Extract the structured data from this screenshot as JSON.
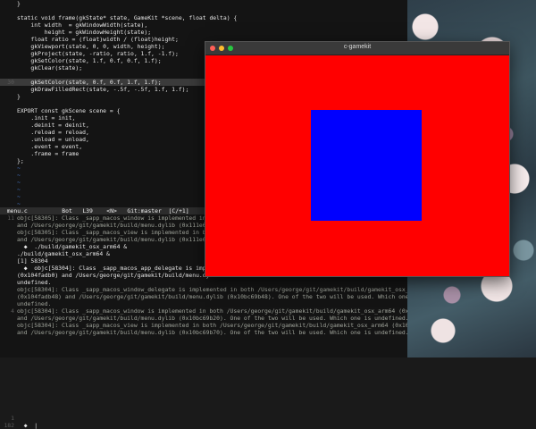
{
  "editor": {
    "code_lines": [
      {
        "num": "",
        "text": "}"
      },
      {
        "num": "",
        "text": ""
      },
      {
        "num": "",
        "text": "static void frame(gkState* state, GameKit *scene, float delta) {"
      },
      {
        "num": "",
        "text": "    int width  = gkWindowWidth(state),"
      },
      {
        "num": "",
        "text": "        height = gkWindowHeight(state);"
      },
      {
        "num": "",
        "text": "    float ratio = (float)width / (float)height;"
      },
      {
        "num": "",
        "text": "    gkViewport(state, 0, 0, width, height);"
      },
      {
        "num": "",
        "text": "    gkProject(state, -ratio, ratio, 1.f, -1.f);"
      },
      {
        "num": "",
        "text": "    gkSetColor(state, 1.f, 0.f, 0.f, 1.f);"
      },
      {
        "num": "",
        "text": "    gkClear(state);"
      },
      {
        "num": "",
        "text": ""
      },
      {
        "num": "30",
        "text": "    gkSetColor(state, 0.f, 0.f, 1.f, 1.f);",
        "highlight": true
      },
      {
        "num": "",
        "text": "    gkDrawFilledRect(state, -.5f, -.5f, 1.f, 1.f);"
      },
      {
        "num": "",
        "text": "}"
      },
      {
        "num": "",
        "text": ""
      },
      {
        "num": "",
        "text": "EXPORT const gkScene scene = {"
      },
      {
        "num": "",
        "text": "    .init = init,"
      },
      {
        "num": "",
        "text": "    .deinit = deinit,"
      },
      {
        "num": "",
        "text": "    .reload = reload,"
      },
      {
        "num": "",
        "text": "    .unload = unload,"
      },
      {
        "num": "",
        "text": "    .event = event,"
      },
      {
        "num": "",
        "text": "    .frame = frame"
      },
      {
        "num": "",
        "text": "};"
      },
      {
        "num": "",
        "text": "~"
      },
      {
        "num": "",
        "text": "~"
      },
      {
        "num": "",
        "text": "~"
      },
      {
        "num": "",
        "text": "~"
      },
      {
        "num": "",
        "text": "~"
      },
      {
        "num": "",
        "text": "~"
      }
    ],
    "status_line": "  menu.c          Bot   L39    <N>   Git:master  [C/+1]"
  },
  "output": {
    "lines": [
      {
        "num": "11",
        "text": "objc[58305]: Class _sapp_macos_window is implemented in both"
      },
      {
        "num": "",
        "text": "and /Users/george/git/gamekit/build/menu.dylib (0x111e69b20)"
      },
      {
        "num": "",
        "text": "objc[58305]: Class _sapp_macos_view is implemented in both /U"
      },
      {
        "num": "",
        "text": "and /Users/george/git/gamekit/build/menu.dylib (0x111e69b70)"
      },
      {
        "num": "",
        "text": "  ◆  ./build/gamekit_osx_arm64 &",
        "bright": true
      },
      {
        "num": "",
        "text": "./build/gamekit_osx_arm64 &",
        "bright": true
      },
      {
        "num": "",
        "text": "[1] 58304",
        "bright": true
      },
      {
        "num": "",
        "text": "  ◆  objc[58304]: Class _sapp_macos_app_delegate is implemented",
        "bright": true
      },
      {
        "num": "",
        "text": "(0x104fadb0) and /Users/george/git/gamekit/build/menu.dylib",
        "bright": true
      },
      {
        "num": "",
        "text": "undefined.",
        "bright": true
      },
      {
        "num": "",
        "text": "objc[58304]: Class _sapp_macos_window_delegate is implemented in both /Users/george/git/gamekit/build/gamekit_osx_arm64"
      },
      {
        "num": "",
        "text": "(0x104fadb48) and /Users/george/git/gamekit/build/menu.dylib (0x10bc69b48). One of the two will be used. Which one is"
      },
      {
        "num": "",
        "text": "undefined."
      },
      {
        "num": "4",
        "text": "objc[58304]: Class _sapp_macos_window is implemented in both /Users/george/git/gamekit/build/gamekit_osx_arm64 (0x104fadb20)"
      },
      {
        "num": "",
        "text": "and /Users/george/git/gamekit/build/menu.dylib (0x10bc69b20). One of the two will be used. Which one is undefined."
      },
      {
        "num": "",
        "text": "objc[58304]: Class _sapp_macos_view is implemented in both /Users/george/git/gamekit/build/gamekit_osx_arm64 (0x104fadb70)"
      },
      {
        "num": "",
        "text": "and /Users/george/git/gamekit/build/menu.dylib (0x10bc69b70). One of the two will be used. Which one is undefined."
      },
      {
        "num": "",
        "text": ""
      },
      {
        "num": "",
        "text": ""
      },
      {
        "num": "",
        "text": ""
      },
      {
        "num": "",
        "text": ""
      },
      {
        "num": "",
        "text": ""
      },
      {
        "num": "",
        "text": ""
      },
      {
        "num": "",
        "text": ""
      },
      {
        "num": "",
        "text": ""
      },
      {
        "num": "",
        "text": ""
      },
      {
        "num": "",
        "text": ""
      },
      {
        "num": "",
        "text": ""
      },
      {
        "num": "1",
        "text": ""
      },
      {
        "num": "182",
        "text": "  ◆  |",
        "bright": true
      }
    ]
  },
  "gamekit_window": {
    "title": "c-gamekit",
    "clear_color": "#ff0000",
    "rect_color": "#0000ff"
  },
  "colors": {
    "terminal_bg": "#141414",
    "tilde": "#4a7fd4",
    "error_brace": "#e05252"
  }
}
